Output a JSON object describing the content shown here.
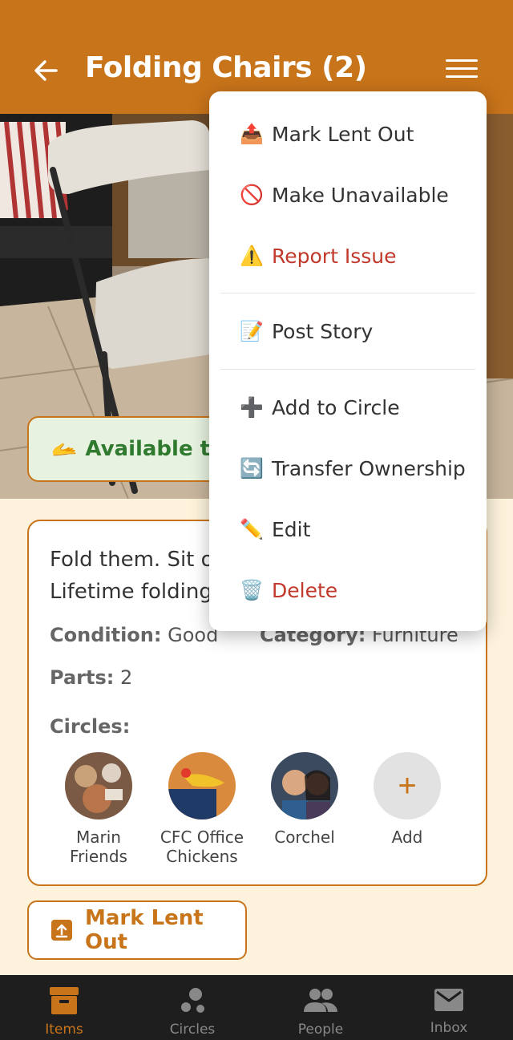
{
  "header": {
    "title": "Folding Chairs (2)"
  },
  "status": {
    "icon": "🫴",
    "label": "Available to lend"
  },
  "item": {
    "description": "Fold them. Sit on them. A pair of Lifetime folding chairs.",
    "condition_label": "Condition:",
    "condition_value": "Good",
    "category_label": "Category:",
    "category_value": "Furniture",
    "parts_label": "Parts:",
    "parts_value": "2",
    "circles_label": "Circles:"
  },
  "circles": [
    {
      "name_line1": "Marin",
      "name_line2": "Friends"
    },
    {
      "name_line1": "CFC Office",
      "name_line2": "Chickens"
    },
    {
      "name_line1": "Corchel",
      "name_line2": ""
    },
    {
      "name_line1": "Add",
      "name_line2": ""
    }
  ],
  "actions": {
    "mark_lent_out": "Mark Lent Out"
  },
  "menu": {
    "items": [
      {
        "icon": "📤",
        "label": "Mark Lent Out"
      },
      {
        "icon": "🚫",
        "label": "Make Unavailable"
      },
      {
        "icon": "⚠️",
        "label": "Report Issue"
      },
      {
        "icon": "📝",
        "label": "Post Story"
      },
      {
        "icon": "➕",
        "label": "Add to Circle"
      },
      {
        "icon": "🔄",
        "label": "Transfer Ownership"
      },
      {
        "icon": "✏️",
        "label": "Edit"
      },
      {
        "icon": "🗑️",
        "label": "Delete"
      }
    ]
  },
  "nav": {
    "items": [
      {
        "label": "Items"
      },
      {
        "label": "Circles"
      },
      {
        "label": "People"
      },
      {
        "label": "Inbox"
      }
    ]
  },
  "colors": {
    "brand": "#c8741a",
    "danger": "#c0392b",
    "available": "#2f7a2f",
    "nav_bg": "#1e1e1e"
  }
}
